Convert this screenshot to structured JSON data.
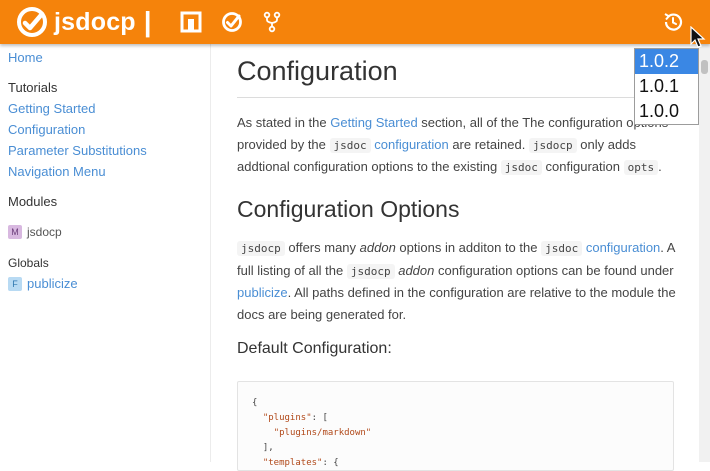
{
  "header": {
    "brand": "jsdocp",
    "separator": "|",
    "icons": [
      "jsdocp-logo-icon",
      "module-icon",
      "check-circle-icon",
      "fork-icon",
      "history-icon"
    ]
  },
  "versions": {
    "options": [
      "1.0.2",
      "1.0.1",
      "1.0.0"
    ],
    "selected": "1.0.2"
  },
  "sidebar": {
    "home": "Home",
    "tutorials_heading": "Tutorials",
    "tutorials": [
      "Getting Started",
      "Configuration",
      "Parameter Substitutions",
      "Navigation Menu"
    ],
    "modules_heading": "Modules",
    "modules": [
      {
        "badge": "M",
        "label": "jsdocp"
      }
    ],
    "globals_heading": "Globals",
    "globals": [
      {
        "badge": "F",
        "label": "publicize"
      }
    ]
  },
  "main": {
    "title": "Configuration",
    "intro": {
      "t1": "As stated in the ",
      "link1": "Getting Started",
      "t2": " section, all of the The configuration options provided by the ",
      "code1": "jsdoc",
      "link2": "configuration",
      "t3": " are retained. ",
      "code2": "jsdocp",
      "t4": " only adds addtional configuration options to the existing ",
      "code3": "jsdoc",
      "t5": " configuration ",
      "code4": "opts",
      "t6": "."
    },
    "options_title": "Configuration Options",
    "options_para": {
      "code1": "jsdocp",
      "t1": " offers many ",
      "em1": "addon",
      "t2": " options in additon to the ",
      "code2": "jsdoc",
      "link1": "configuration",
      "t3": ". A full listing of all the ",
      "code3": "jsdocp",
      "em2": "addon",
      "t4": " configuration options can be found under ",
      "link2": "publicize",
      "t5": ". All paths defined in the configuration are relative to the module the docs are being generated for."
    },
    "default_title": "Default Configuration:",
    "code_lines": [
      "{",
      "  \"plugins\": [",
      "    \"plugins/markdown\"",
      "  ],",
      "  \"templates\": {"
    ]
  },
  "colors": {
    "header": "#f5830b",
    "link": "#4a8ed4",
    "selected": "#3a87e4"
  }
}
